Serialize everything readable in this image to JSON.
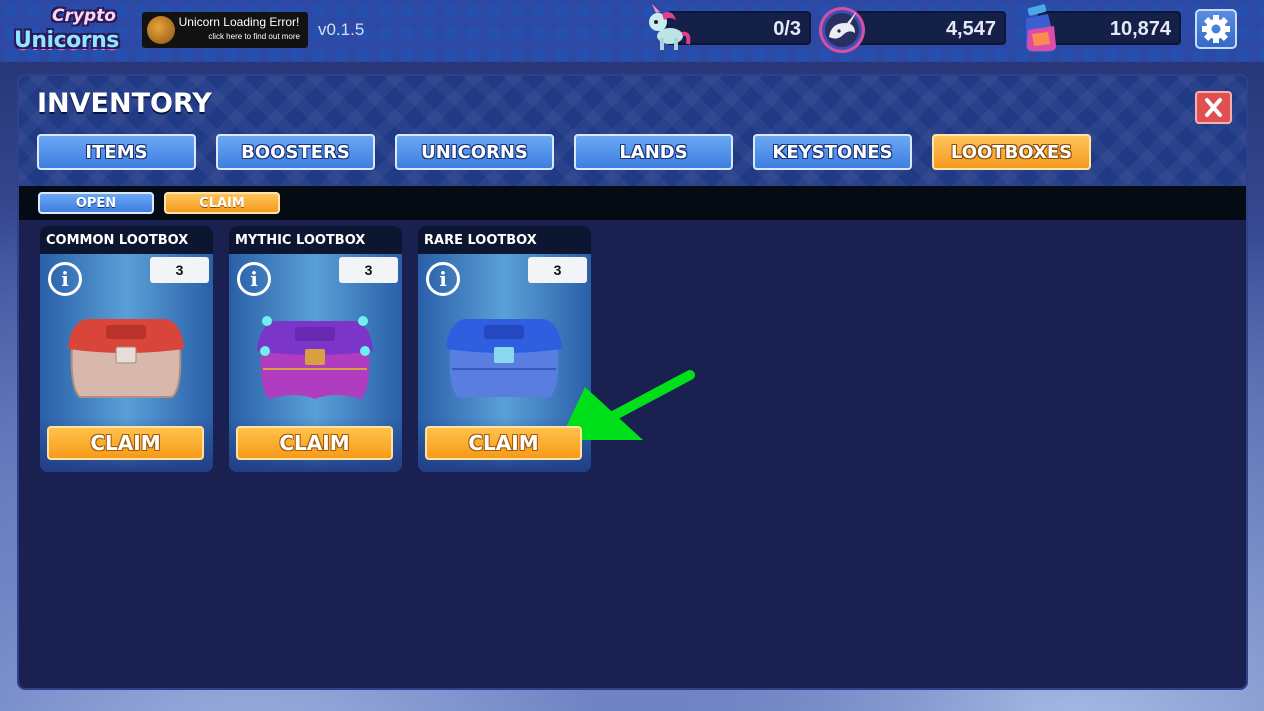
{
  "header": {
    "logo": {
      "line1": "Crypto",
      "line2": "Unicorns"
    },
    "error_button": {
      "title": "Unicorn Loading Error!",
      "subtitle": "click here to find out more"
    },
    "version": "v0.1.5",
    "stats": [
      {
        "icon": "unicorn-icon",
        "value": "0/3"
      },
      {
        "icon": "narwhal-token-icon",
        "value": "4,547"
      },
      {
        "icon": "potion-icon",
        "value": "10,874"
      }
    ],
    "settings_icon": "gear-icon"
  },
  "inventory": {
    "title": "INVENTORY",
    "close_icon": "close-icon",
    "tabs": [
      {
        "label": "ITEMS",
        "active": false
      },
      {
        "label": "BOOSTERS",
        "active": false
      },
      {
        "label": "UNICORNS",
        "active": false
      },
      {
        "label": "LANDS",
        "active": false
      },
      {
        "label": "KEYSTONES",
        "active": false
      },
      {
        "label": "LOOTBOXES",
        "active": true
      }
    ],
    "subtabs": [
      {
        "label": "OPEN",
        "active": false
      },
      {
        "label": "CLAIM",
        "active": true
      }
    ],
    "lootboxes": [
      {
        "name": "COMMON LOOTBOX",
        "count": "3",
        "button": "CLAIM",
        "color": "#d9453a"
      },
      {
        "name": "MYTHIC LOOTBOX",
        "count": "3",
        "button": "CLAIM",
        "color": "#8a2fc4"
      },
      {
        "name": "RARE LOOTBOX",
        "count": "3",
        "button": "CLAIM",
        "color": "#2f5fe0"
      }
    ],
    "info_glyph": "i"
  },
  "annotation": {
    "arrow_color": "#00e01a"
  }
}
